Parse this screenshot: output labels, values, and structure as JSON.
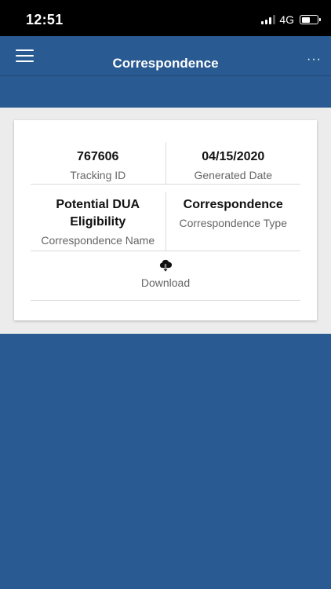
{
  "status_bar": {
    "time": "12:51",
    "network": "4G",
    "battery_level": 0.6,
    "signal_bars": 3
  },
  "header": {
    "title": "Correspondence",
    "more_label": "···"
  },
  "card": {
    "tracking_id": {
      "value": "767606",
      "label": "Tracking ID"
    },
    "generated_date": {
      "value": "04/15/2020",
      "label": "Generated Date"
    },
    "correspondence_name": {
      "value": "Potential DUA Eligibility",
      "label": "Correspondence Name"
    },
    "correspondence_type": {
      "value": "Correspondence",
      "label": "Correspondence Type"
    },
    "download": {
      "label": "Download",
      "icon": "cloud-download-icon"
    }
  },
  "colors": {
    "brand_blue": "#2a5a92",
    "background_gray": "#ececec",
    "status_bar": "#000000"
  }
}
